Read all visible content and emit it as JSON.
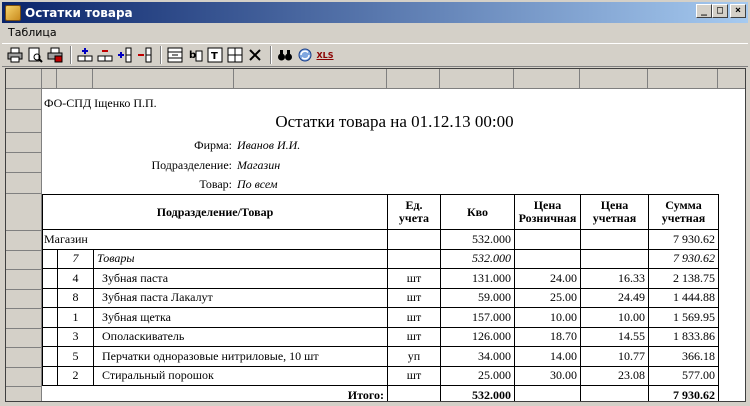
{
  "window": {
    "title": "Остатки товара",
    "buttons": {
      "minimize": "_",
      "maximize": "□",
      "close": "×"
    }
  },
  "menu": {
    "items": [
      "Таблица"
    ]
  },
  "toolbar": {
    "xls_label": "XLS"
  },
  "report": {
    "company": "ФО-СПД Іщенко П.П.",
    "title": "Остатки товара на 01.12.13 00:00",
    "params": [
      {
        "label": "Фирма:",
        "value": "Иванов И.И."
      },
      {
        "label": "Подразделение:",
        "value": "Магазин"
      },
      {
        "label": "Товар:",
        "value": "По всем"
      }
    ]
  },
  "table": {
    "headers": {
      "item": "Подразделение/Товар",
      "unit": "Ед. учета",
      "qty": "Кво",
      "retail_price": "Цена Розничная",
      "acc_price": "Цена учетная",
      "acc_sum": "Сумма учетная"
    },
    "division": {
      "name": "Магазин",
      "qty": "532.000",
      "sum": "7 930.62"
    },
    "group": {
      "code": "7",
      "name": "Товары",
      "qty": "532.000",
      "sum": "7 930.62"
    },
    "rows": [
      {
        "code": "4",
        "name": "Зубная паста",
        "unit": "шт",
        "qty": "131.000",
        "retail": "24.00",
        "acc": "16.33",
        "sum": "2 138.75"
      },
      {
        "code": "8",
        "name": "Зубная паста Лакалут",
        "unit": "шт",
        "qty": "59.000",
        "retail": "25.00",
        "acc": "24.49",
        "sum": "1 444.88"
      },
      {
        "code": "1",
        "name": "Зубная щетка",
        "unit": "шт",
        "qty": "157.000",
        "retail": "10.00",
        "acc": "10.00",
        "sum": "1 569.95"
      },
      {
        "code": "3",
        "name": "Ополаскиватель",
        "unit": "шт",
        "qty": "126.000",
        "retail": "18.70",
        "acc": "14.55",
        "sum": "1 833.86"
      },
      {
        "code": "5",
        "name": "Перчатки одноразовые нитриловые, 10 шт",
        "unit": "уп",
        "qty": "34.000",
        "retail": "14.00",
        "acc": "10.77",
        "sum": "366.18"
      },
      {
        "code": "2",
        "name": "Стиральный порошок",
        "unit": "шт",
        "qty": "25.000",
        "retail": "30.00",
        "acc": "23.08",
        "sum": "577.00"
      }
    ],
    "total": {
      "label": "Итого:",
      "qty": "532.000",
      "sum": "7 930.62"
    }
  }
}
